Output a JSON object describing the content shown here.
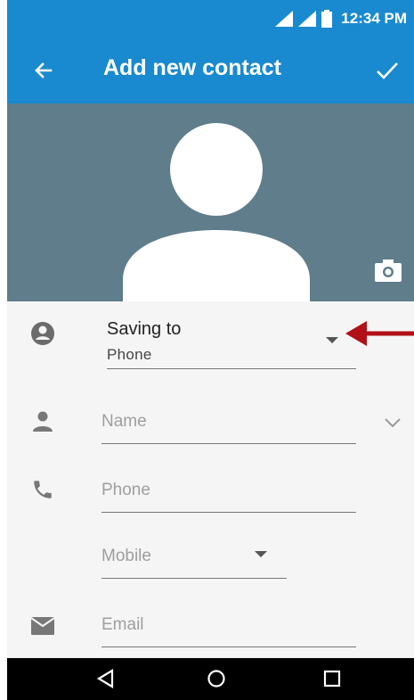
{
  "status_bar": {
    "time": "12:34 PM"
  },
  "app_bar": {
    "title": "Add new contact",
    "back_icon": "arrow-left-icon",
    "save_icon": "check-icon"
  },
  "photo": {
    "camera_icon": "camera-icon"
  },
  "saving_to": {
    "label": "Saving to",
    "value": "Phone"
  },
  "fields": {
    "name_placeholder": "Name",
    "phone_placeholder": "Phone",
    "phone_type": "Mobile",
    "email_placeholder": "Email"
  },
  "colors": {
    "primary": "#1a8ad0",
    "photo_bg": "#607d8b",
    "annotation_arrow": "#b11116"
  }
}
